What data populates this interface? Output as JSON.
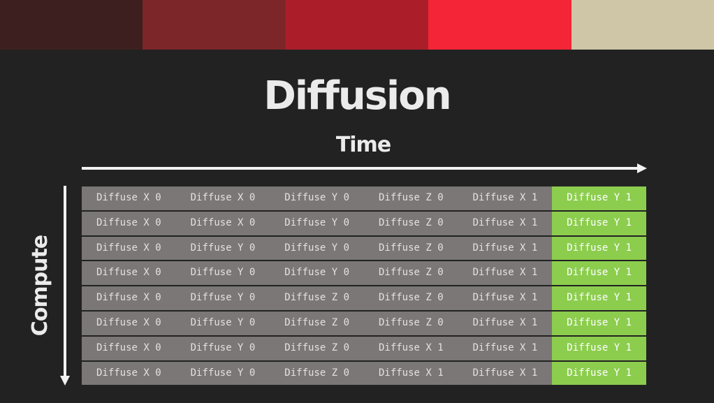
{
  "title": "Diffusion",
  "time_axis_label": "Time",
  "compute_axis_label": "Compute",
  "palette": [
    "#3e1f1f",
    "#7d262a",
    "#ab1e29",
    "#f42537",
    "#cec6a6"
  ],
  "colors": {
    "background": "#222222",
    "cell_grey": "#7a7776",
    "cell_highlight": "#8ccd4e"
  },
  "highlight_column": 5,
  "rows": [
    [
      "Diffuse X 0",
      "Diffuse X 0",
      "Diffuse Y 0",
      "Diffuse Z 0",
      "Diffuse X 1",
      "Diffuse Y 1"
    ],
    [
      "Diffuse X 0",
      "Diffuse X 0",
      "Diffuse Y 0",
      "Diffuse Z 0",
      "Diffuse X 1",
      "Diffuse Y 1"
    ],
    [
      "Diffuse X 0",
      "Diffuse Y 0",
      "Diffuse Y 0",
      "Diffuse Z 0",
      "Diffuse X 1",
      "Diffuse Y 1"
    ],
    [
      "Diffuse X 0",
      "Diffuse Y 0",
      "Diffuse Y 0",
      "Diffuse Z 0",
      "Diffuse X 1",
      "Diffuse Y 1"
    ],
    [
      "Diffuse X 0",
      "Diffuse Y 0",
      "Diffuse Z 0",
      "Diffuse Z 0",
      "Diffuse X 1",
      "Diffuse Y 1"
    ],
    [
      "Diffuse X 0",
      "Diffuse Y 0",
      "Diffuse Z 0",
      "Diffuse Z 0",
      "Diffuse X 1",
      "Diffuse Y 1"
    ],
    [
      "Diffuse X 0",
      "Diffuse Y 0",
      "Diffuse Z 0",
      "Diffuse X 1",
      "Diffuse X 1",
      "Diffuse Y 1"
    ],
    [
      "Diffuse X 0",
      "Diffuse Y 0",
      "Diffuse Z 0",
      "Diffuse X 1",
      "Diffuse X 1",
      "Diffuse Y 1"
    ]
  ]
}
